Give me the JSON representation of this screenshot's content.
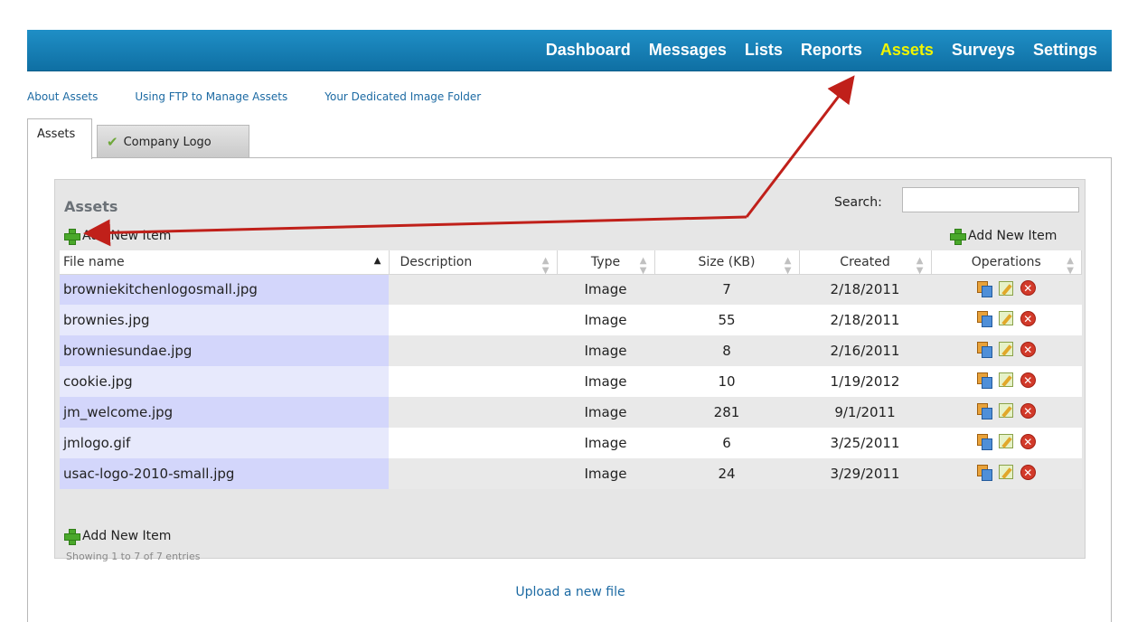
{
  "nav": {
    "items": [
      {
        "label": "Dashboard",
        "active": false
      },
      {
        "label": "Messages",
        "active": false
      },
      {
        "label": "Lists",
        "active": false
      },
      {
        "label": "Reports",
        "active": false
      },
      {
        "label": "Assets",
        "active": true
      },
      {
        "label": "Surveys",
        "active": false
      },
      {
        "label": "Settings",
        "active": false
      }
    ],
    "active_color": "#f2f500"
  },
  "sublinks": [
    "About Assets",
    "Using FTP to Manage Assets",
    "Your Dedicated Image Folder"
  ],
  "tabs": {
    "assets": "Assets",
    "company_logo": "Company Logo"
  },
  "grid": {
    "title": "Assets",
    "search_label": "Search:",
    "search_value": "",
    "add_item": "Add New Item",
    "columns": [
      "File name",
      "Description",
      "Type",
      "Size (KB)",
      "Created",
      "Operations"
    ],
    "rows": [
      {
        "file": "browniekitchenlogosmall.jpg",
        "description": "",
        "type": "Image",
        "size": "7",
        "created": "2/18/2011"
      },
      {
        "file": "brownies.jpg",
        "description": "",
        "type": "Image",
        "size": "55",
        "created": "2/18/2011"
      },
      {
        "file": "browniesundae.jpg",
        "description": "",
        "type": "Image",
        "size": "8",
        "created": "2/16/2011"
      },
      {
        "file": "cookie.jpg",
        "description": "",
        "type": "Image",
        "size": "10",
        "created": "1/19/2012"
      },
      {
        "file": "jm_welcome.jpg",
        "description": "",
        "type": "Image",
        "size": "281",
        "created": "9/1/2011"
      },
      {
        "file": "jmlogo.gif",
        "description": "",
        "type": "Image",
        "size": "6",
        "created": "3/25/2011"
      },
      {
        "file": "usac-logo-2010-small.jpg",
        "description": "",
        "type": "Image",
        "size": "24",
        "created": "3/29/2011"
      }
    ],
    "showing": "Showing 1 to 7 of 7 entries"
  },
  "upload_link": "Upload a new file",
  "colors": {
    "nav_bg": "#1580b8",
    "link": "#1c6aa3",
    "annotation_arrow": "#c0201a"
  }
}
